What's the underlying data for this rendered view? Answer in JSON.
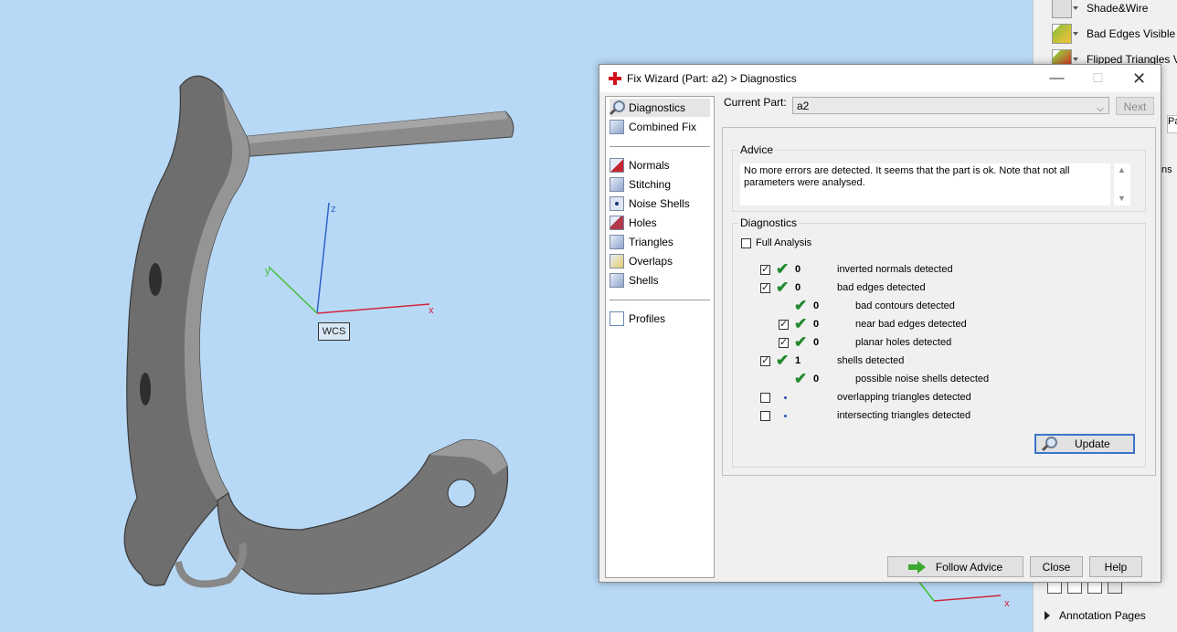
{
  "viewport": {
    "wcs_label": "WCS",
    "axes": {
      "x": "x",
      "y": "y",
      "z": "z"
    }
  },
  "right_panel": {
    "items": [
      {
        "label": "Shade&Wire",
        "icon": "shade-wire-icon"
      },
      {
        "label": "Bad Edges Visible",
        "icon": "bad-edges-icon"
      },
      {
        "label": "Flipped Triangles Vi",
        "icon": "flipped-triangles-icon"
      }
    ],
    "clipped_labels": [
      "Pa",
      "ns"
    ],
    "annotation_pages": "Annotation Pages"
  },
  "dialog": {
    "title": "Fix Wizard (Part: a2) > Diagnostics",
    "nav": {
      "group1": [
        "Diagnostics",
        "Combined Fix"
      ],
      "group2": [
        "Normals",
        "Stitching",
        "Noise Shells",
        "Holes",
        "Triangles",
        "Overlaps",
        "Shells"
      ],
      "group3": [
        "Profiles"
      ],
      "selected": "Diagnostics"
    },
    "current_part_label": "Current Part:",
    "current_part_value": "a2",
    "next_label": "Next",
    "advice": {
      "title": "Advice",
      "text": "No more errors are detected. It seems that the part is ok. Note that not all parameters were analysed."
    },
    "diagnostics": {
      "title": "Diagnostics",
      "full_analysis_label": "Full Analysis",
      "full_analysis_checked": false,
      "rows": [
        {
          "checkbox": "checked",
          "status": "ok",
          "count": "0",
          "label": "inverted normals detected",
          "indent": 0
        },
        {
          "checkbox": "checked",
          "status": "ok",
          "count": "0",
          "label": "bad edges detected",
          "indent": 0
        },
        {
          "checkbox": "none",
          "status": "ok",
          "count": "0",
          "label": "bad contours detected",
          "indent": 1
        },
        {
          "checkbox": "checked",
          "status": "ok",
          "count": "0",
          "label": "near bad edges detected",
          "indent": 1
        },
        {
          "checkbox": "checked",
          "status": "ok",
          "count": "0",
          "label": "planar holes detected",
          "indent": 1
        },
        {
          "checkbox": "checked",
          "status": "ok",
          "count": "1",
          "label": "shells detected",
          "indent": 0
        },
        {
          "checkbox": "none",
          "status": "ok",
          "count": "0",
          "label": "possible noise shells detected",
          "indent": 1
        },
        {
          "checkbox": "unchecked",
          "status": "pending",
          "count": "",
          "label": "overlapping triangles detected",
          "indent": 0
        },
        {
          "checkbox": "unchecked",
          "status": "pending",
          "count": "",
          "label": "intersecting triangles detected",
          "indent": 0
        }
      ],
      "update_label": "Update"
    },
    "buttons": {
      "follow_advice": "Follow Advice",
      "close": "Close",
      "help": "Help"
    }
  }
}
